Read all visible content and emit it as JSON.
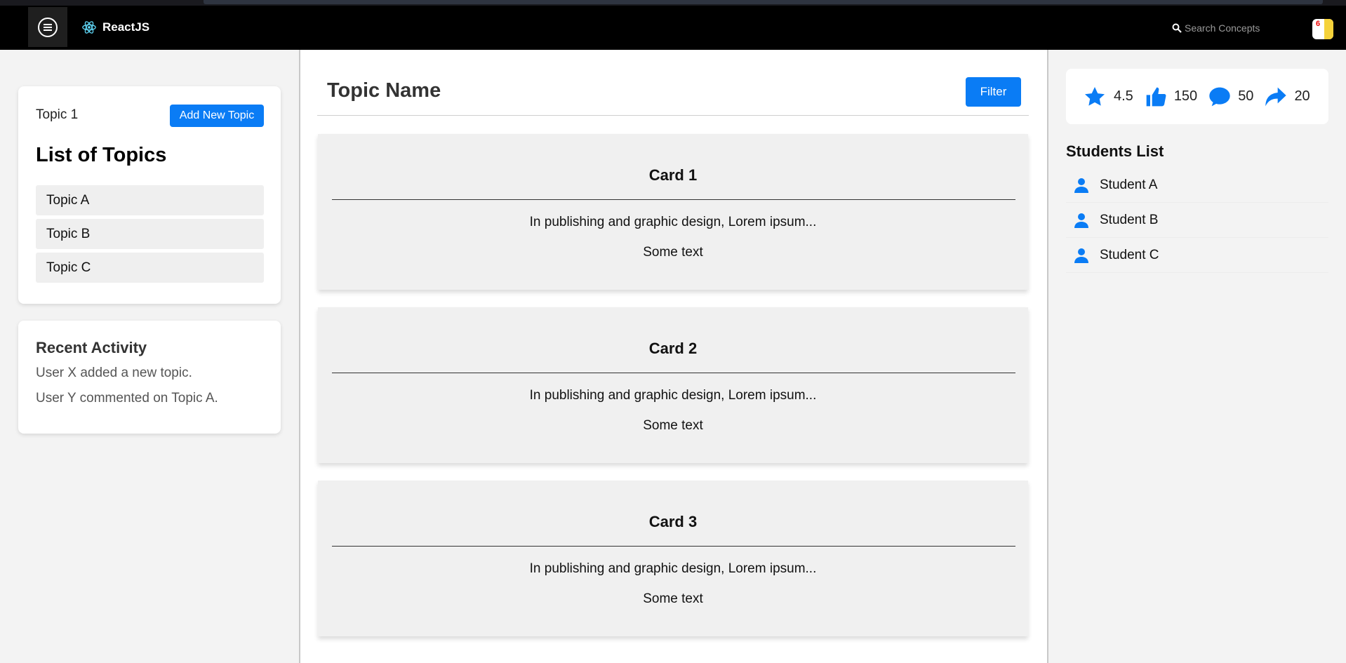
{
  "header": {
    "menu_icon": "menu-icon",
    "brand": "ReactJS",
    "brand_icon": "react-atom-icon",
    "search_icon": "search-icon",
    "search_placeholder": "Search Concepts",
    "notification_count": "6"
  },
  "left": {
    "current_topic": "Topic 1",
    "add_button": "Add New Topic",
    "list_title": "List of Topics",
    "topics": [
      "Topic A",
      "Topic B",
      "Topic C"
    ],
    "activity": {
      "title": "Recent Activity",
      "items": [
        "User X added a new topic.",
        "User Y commented on Topic A."
      ]
    }
  },
  "center": {
    "title": "Topic Name",
    "filter_button": "Filter",
    "cards": [
      {
        "title": "Card 1",
        "description": "In publishing and graphic design, Lorem ipsum...",
        "text": "Some text"
      },
      {
        "title": "Card 2",
        "description": "In publishing and graphic design, Lorem ipsum...",
        "text": "Some text"
      },
      {
        "title": "Card 3",
        "description": "In publishing and graphic design, Lorem ipsum...",
        "text": "Some text"
      }
    ]
  },
  "right": {
    "stats": {
      "rating": "4.5",
      "likes": "150",
      "comments": "50",
      "shares": "20"
    },
    "students_title": "Students List",
    "students": [
      "Student A",
      "Student B",
      "Student C"
    ]
  },
  "colors": {
    "accent": "#0a7cf5",
    "header_bg": "#000000",
    "card_bg": "#f0f0f0",
    "react_cyan": "#61dafb"
  }
}
